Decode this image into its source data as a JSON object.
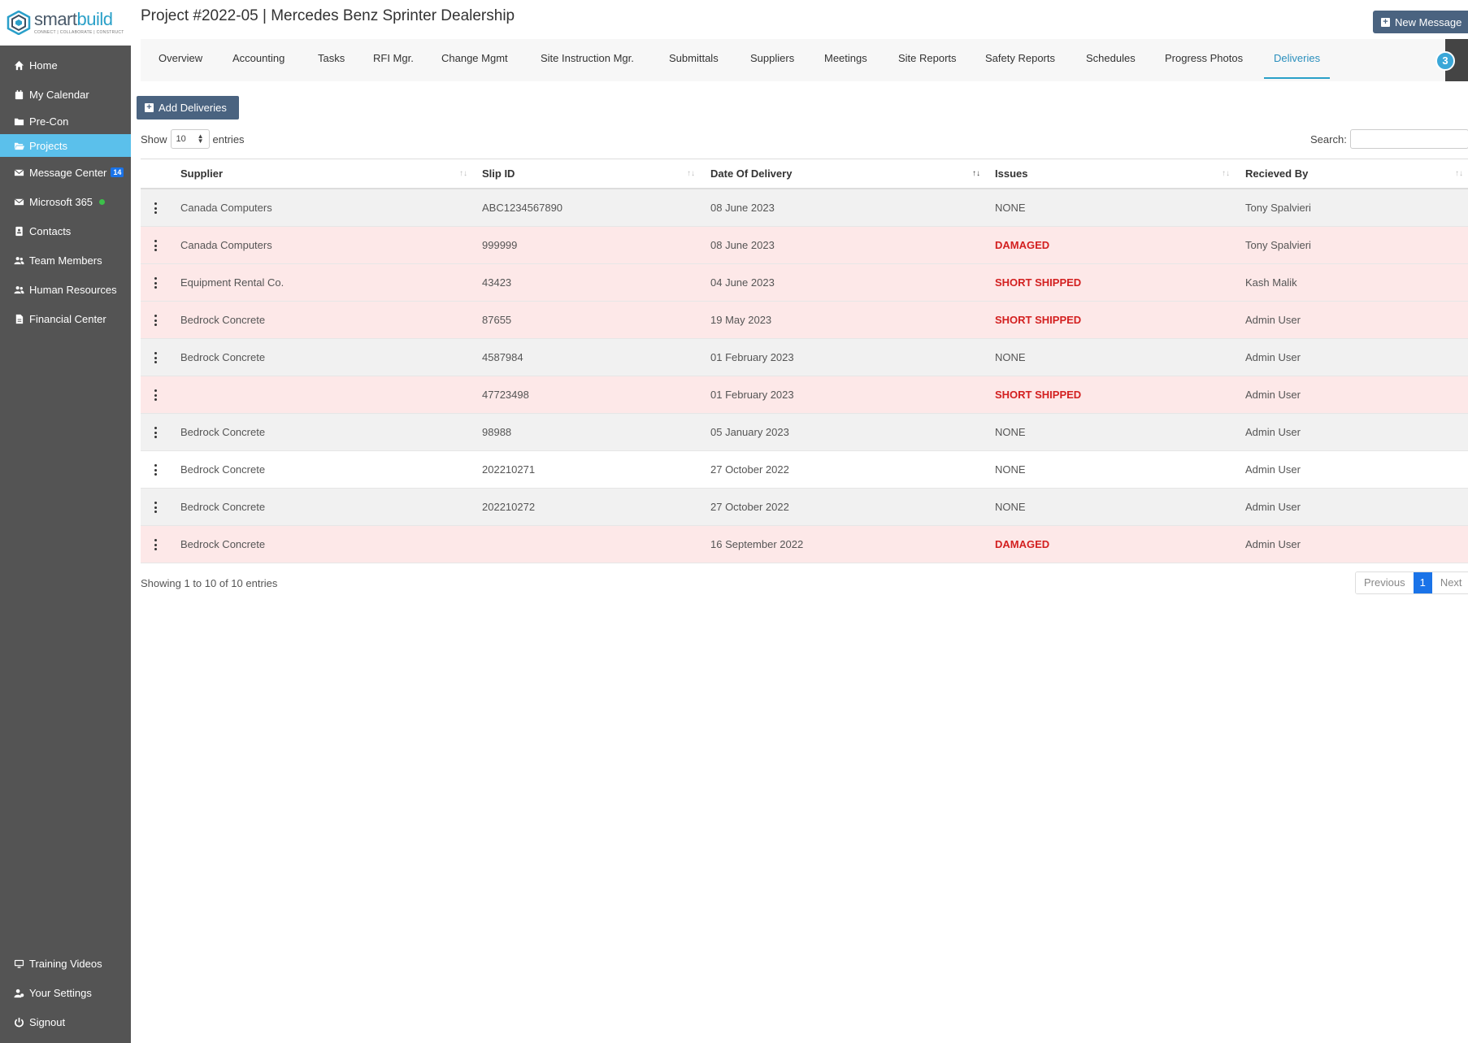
{
  "app": {
    "logo_word_a": "smart",
    "logo_word_b": "build",
    "logo_tagline": "CONNECT | COLLABORATE | CONSTRUCT"
  },
  "sidebar": {
    "items": [
      {
        "label": "Home",
        "icon": "home-icon"
      },
      {
        "label": "My Calendar",
        "icon": "calendar-icon"
      },
      {
        "label": "Pre-Con",
        "icon": "folder-icon"
      },
      {
        "label": "Projects",
        "icon": "folder-open-icon"
      },
      {
        "label": "Message Center",
        "icon": "envelope-icon",
        "badge": "14"
      },
      {
        "label": "Microsoft 365",
        "icon": "envelope-icon",
        "status": "online"
      },
      {
        "label": "Contacts",
        "icon": "address-book-icon"
      },
      {
        "label": "Team Members",
        "icon": "users-icon"
      },
      {
        "label": "Human Resources",
        "icon": "users-icon"
      },
      {
        "label": "Financial Center",
        "icon": "file-icon"
      }
    ],
    "bottom_items": [
      {
        "label": "Training Videos",
        "icon": "monitor-icon"
      },
      {
        "label": "Your Settings",
        "icon": "user-gear-icon"
      },
      {
        "label": "Signout",
        "icon": "power-icon"
      }
    ],
    "active_item": "Projects"
  },
  "header": {
    "title": "Project #2022-05 | Mercedes Benz Sprinter Dealership",
    "new_message_label": "New Message",
    "notification_count": "3"
  },
  "tabs": [
    "Overview",
    "Accounting",
    "Tasks",
    "RFI Mgr.",
    "Change Mgmt",
    "Site Instruction Mgr.",
    "Submittals",
    "Suppliers",
    "Meetings",
    "Site Reports",
    "Safety Reports",
    "Schedules",
    "Progress Photos",
    "Deliveries"
  ],
  "active_tab": "Deliveries",
  "toolbar": {
    "add_label": "Add Deliveries",
    "show_label": "Show",
    "entries_value": "10",
    "entries_label": "entries",
    "search_label": "Search:",
    "search_value": ""
  },
  "table": {
    "columns": [
      "Supplier",
      "Slip ID",
      "Date Of Delivery",
      "Issues",
      "Recieved By"
    ],
    "rows": [
      {
        "supplier": "Canada Computers",
        "slip_id": "ABC1234567890",
        "date": "08 June 2023",
        "issues": "NONE",
        "received_by": "Tony Spalvieri"
      },
      {
        "supplier": "Canada Computers",
        "slip_id": "999999",
        "date": "08 June 2023",
        "issues": "DAMAGED",
        "received_by": "Tony Spalvieri"
      },
      {
        "supplier": "Equipment Rental Co.",
        "slip_id": "43423",
        "date": "04 June 2023",
        "issues": "SHORT SHIPPED",
        "received_by": "Kash Malik"
      },
      {
        "supplier": "Bedrock Concrete",
        "slip_id": "87655",
        "date": "19 May 2023",
        "issues": "SHORT SHIPPED",
        "received_by": "Admin User"
      },
      {
        "supplier": "Bedrock Concrete",
        "slip_id": "4587984",
        "date": "01 February 2023",
        "issues": "NONE",
        "received_by": "Admin User"
      },
      {
        "supplier": "",
        "slip_id": "47723498",
        "date": "01 February 2023",
        "issues": "SHORT SHIPPED",
        "received_by": "Admin User"
      },
      {
        "supplier": "Bedrock Concrete",
        "slip_id": "98988",
        "date": "05 January 2023",
        "issues": "NONE",
        "received_by": "Admin User"
      },
      {
        "supplier": "Bedrock Concrete",
        "slip_id": "202210271",
        "date": "27 October 2022",
        "issues": "NONE",
        "received_by": "Admin User"
      },
      {
        "supplier": "Bedrock Concrete",
        "slip_id": "202210272",
        "date": "27 October 2022",
        "issues": "NONE",
        "received_by": "Admin User"
      },
      {
        "supplier": "Bedrock Concrete",
        "slip_id": "",
        "date": "16 September 2022",
        "issues": "DAMAGED",
        "received_by": "Admin User"
      }
    ]
  },
  "footer": {
    "info": "Showing 1 to 10 of 10 entries",
    "previous_label": "Previous",
    "current_page": "1",
    "next_label": "Next"
  },
  "colors": {
    "sidebar_bg": "#545454",
    "active_nav": "#5bc0eb",
    "button_bg": "#4a6380",
    "issue_red": "#d32020",
    "row_issue_bg": "#fde8e8",
    "row_ok_bg": "#f1f1f1"
  }
}
